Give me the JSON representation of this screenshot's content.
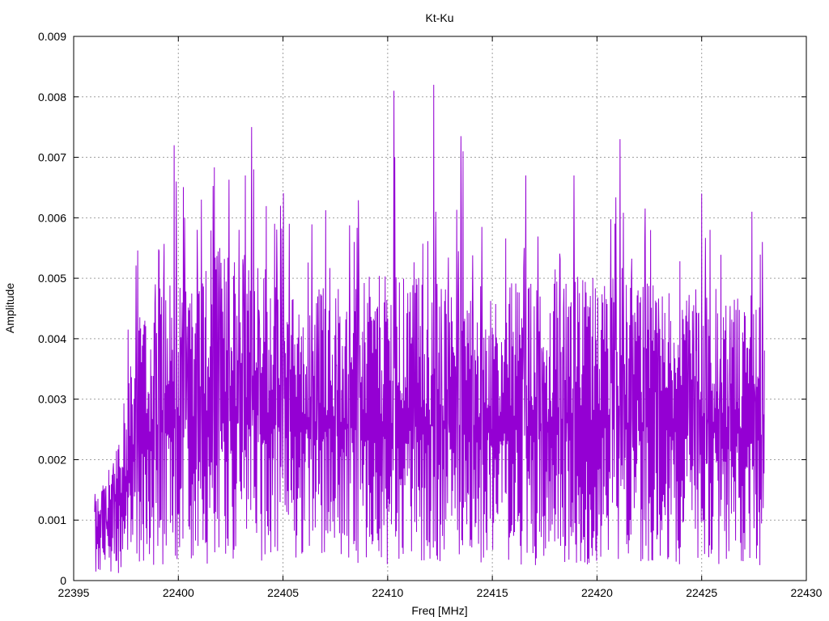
{
  "chart_data": {
    "type": "line",
    "title": "Kt-Ku",
    "xlabel": "Freq [MHz]",
    "ylabel": "Amplitude",
    "xlim": [
      22395,
      22430
    ],
    "ylim": [
      0,
      0.009
    ],
    "x_ticks": [
      22395,
      22400,
      22405,
      22410,
      22415,
      22420,
      22425,
      22430
    ],
    "x_tick_labels": [
      "22395",
      "22400",
      "22405",
      "22410",
      "22415",
      "22420",
      "22425",
      "22430"
    ],
    "y_ticks": [
      0,
      0.001,
      0.002,
      0.003,
      0.004,
      0.005,
      0.006,
      0.007,
      0.008,
      0.009
    ],
    "y_tick_labels": [
      "0",
      "0.001",
      "0.002",
      "0.003",
      "0.004",
      "0.005",
      "0.006",
      "0.007",
      "0.008",
      "0.009"
    ],
    "grid": true,
    "series": [
      {
        "color": "#9400d3",
        "x_range": [
          22396.0,
          22428.0
        ],
        "baseline_trend": [
          [
            22396.0,
            0.0007
          ],
          [
            22397.3,
            0.0013
          ],
          [
            22398.0,
            0.0022
          ],
          [
            22399.5,
            0.0026
          ],
          [
            22403.0,
            0.0029
          ],
          [
            22406.0,
            0.0025
          ],
          [
            22410.0,
            0.0026
          ],
          [
            22415.0,
            0.0025
          ],
          [
            22420.0,
            0.0026
          ],
          [
            22425.0,
            0.0025
          ],
          [
            22428.0,
            0.0024
          ]
        ],
        "peaks": [
          [
            22397.6,
            0.00415
          ],
          [
            22398.9,
            0.0049
          ],
          [
            22399.3,
            0.005
          ],
          [
            22399.8,
            0.0072
          ],
          [
            22399.9,
            0.0066
          ],
          [
            22400.3,
            0.006
          ],
          [
            22400.9,
            0.0058
          ],
          [
            22401.1,
            0.0063
          ],
          [
            22402.9,
            0.0058
          ],
          [
            22403.2,
            0.0067
          ],
          [
            22403.5,
            0.0075
          ],
          [
            22403.6,
            0.0068
          ],
          [
            22404.6,
            0.0059
          ],
          [
            22405.3,
            0.0059
          ],
          [
            22408.4,
            0.0056
          ],
          [
            22410.3,
            0.0081
          ],
          [
            22410.35,
            0.007
          ],
          [
            22412.2,
            0.0082
          ],
          [
            22412.3,
            0.0061
          ],
          [
            22413.5,
            0.00735
          ],
          [
            22413.6,
            0.0071
          ],
          [
            22416.6,
            0.0067
          ],
          [
            22418.9,
            0.0067
          ],
          [
            22421.1,
            0.0073
          ],
          [
            22425.0,
            0.0064
          ],
          [
            22425.4,
            0.0058
          ],
          [
            22427.4,
            0.0061
          ],
          [
            22427.9,
            0.0056
          ]
        ]
      }
    ]
  }
}
